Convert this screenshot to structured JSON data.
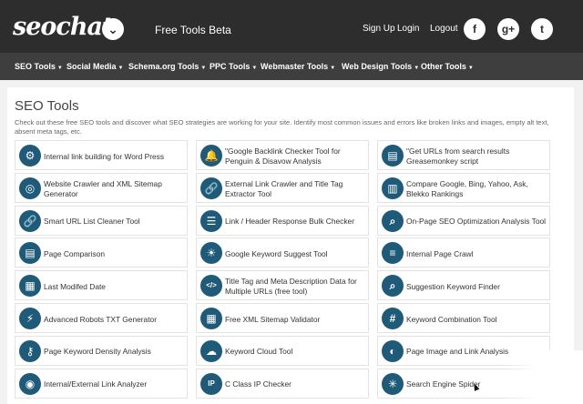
{
  "header": {
    "logo_text": "seochat",
    "logo_badge_icon": "chevron-down-icon",
    "product_label": "Free Tools Beta",
    "signup_label": "Sign Up",
    "login_label": "Login",
    "logout_label": "Logout",
    "social": [
      {
        "name": "facebook-icon",
        "glyph": "f"
      },
      {
        "name": "google-plus-icon",
        "glyph": "g+"
      },
      {
        "name": "twitter-icon",
        "glyph": "t"
      }
    ]
  },
  "nav": {
    "items": [
      "SEO Tools",
      "Social Media",
      "Schema.org Tools",
      "PPC Tools",
      "Webmaster Tools",
      "Web Design Tools",
      "Other Tools"
    ]
  },
  "main": {
    "title": "SEO Tools",
    "description": "Check out these free SEO tools and discover what SEO strategies are working for your site. Identify most common issues and errors like broken links and images, empty alt text, absent meta tags, etc.",
    "tools": [
      [
        "Internal link building for Word Press",
        "\"Google Backlink Checker Tool for Penguin & Disavow Analysis",
        "\"Get URLs from search results Greasemonkey script"
      ],
      [
        "Website Crawler and XML Sitemap Generator",
        "External Link Crawler and Title Tag Extractor Tool",
        "Compare Google, Bing, Yahoo, Ask, Blekko Rankings"
      ],
      [
        "Smart URL List Cleaner Tool",
        "Link / Header Response Bulk Checker",
        "On-Page SEO Optimization Analysis Tool"
      ],
      [
        "Page Comparison",
        "Google Keyword Suggest Tool",
        "Internal Page Crawl"
      ],
      [
        "Last Modifed Date",
        "Title Tag and Meta Description Data for Multiple URLs (free tool)",
        "Suggestion Keyword Finder"
      ],
      [
        "Advanced Robots TXT Generator",
        "Free XML Sitemap Validator",
        "Keyword Combination Tool"
      ],
      [
        "Page Keyword Density Analysis",
        "Keyword Cloud Tool",
        "Page Image and Link Analysis"
      ],
      [
        "Internal/External Link Analyzer",
        "C Class IP Checker",
        "Search Engine Spider"
      ]
    ],
    "icons": [
      [
        "network-icon",
        "bell-icon",
        "tools-icon"
      ],
      [
        "globe-icon",
        "link-icon",
        "bar-chart-icon"
      ],
      [
        "link-icon",
        "document-icon",
        "search-icon"
      ],
      [
        "document-icon",
        "lightbulb-icon",
        "list-icon"
      ],
      [
        "calendar-icon",
        "code-icon",
        "search-icon"
      ],
      [
        "bolt-icon",
        "sitemap-icon",
        "hashtag-icon"
      ],
      [
        "key-icon",
        "cloud-icon",
        "image-icon"
      ],
      [
        "globe-icon",
        "ip-icon",
        "spider-icon"
      ]
    ],
    "icon_glyphs": [
      [
        "⚙",
        "🔔",
        "▤"
      ],
      [
        "◎",
        "🔗",
        "▥"
      ],
      [
        "🔗",
        "☰",
        "⌕"
      ],
      [
        "▤",
        "☀",
        "≡"
      ],
      [
        "▦",
        "</>",
        "⌕"
      ],
      [
        "⚡",
        "▦",
        "#"
      ],
      [
        "⚷",
        "☁",
        "◐"
      ],
      [
        "◉",
        "IP",
        "✳"
      ]
    ]
  }
}
